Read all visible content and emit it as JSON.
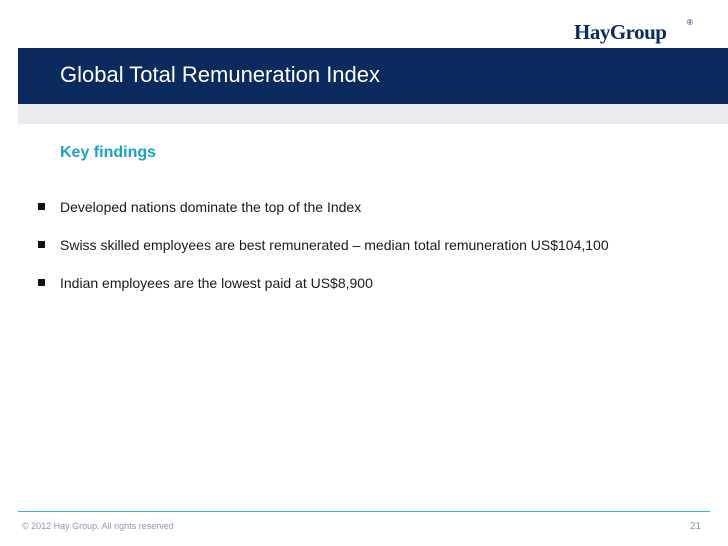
{
  "logo": {
    "text": "HayGroup",
    "mark": "®"
  },
  "title": "Global Total Remuneration Index",
  "subtitle": "Key findings",
  "bullets": [
    "Developed nations dominate the top of the Index",
    "Swiss skilled employees are best remunerated – median total remuneration US$104,100",
    "Indian employees are the lowest paid at US$8,900"
  ],
  "footer": {
    "copyright": "© 2012 Hay Group. All rights reserved",
    "page": "21"
  },
  "colors": {
    "brand_navy": "#0b2a5e",
    "accent_cyan": "#17a2c9",
    "footer_line": "#35b3d6"
  }
}
